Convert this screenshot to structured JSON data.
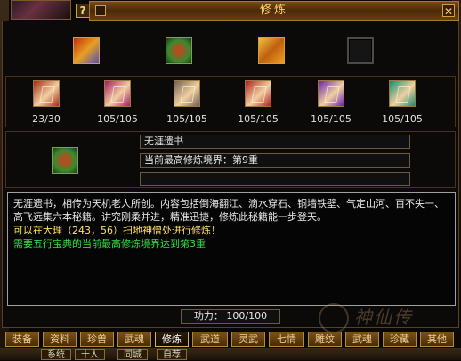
{
  "window": {
    "title": "修炼",
    "help_label": "?",
    "close_label": "✕"
  },
  "top_slots": [
    {
      "icon": "red-scroll-icon"
    },
    {
      "icon": "green-treasure-icon"
    },
    {
      "icon": "gold-scroll-icon"
    },
    {
      "icon": "empty-slot"
    }
  ],
  "books": [
    {
      "count": "23/30",
      "color": "#a82818"
    },
    {
      "count": "105/105",
      "color": "#a8186a"
    },
    {
      "count": "105/105",
      "color": "#706050"
    },
    {
      "count": "105/105",
      "color": "#b02020"
    },
    {
      "count": "105/105",
      "color": "#6a20b0"
    },
    {
      "count": "105/105",
      "color": "#109070"
    }
  ],
  "selected": {
    "name": "无涯遗书",
    "realm": "当前最高修炼境界：第9重",
    "extra": ""
  },
  "description": {
    "text": "无涯遗书，相传为天机老人所创。内容包括倒海翻江、滴水穿石、铜墙铁壁、气定山河、百不失一、高飞远集六本秘籍。讲究刚柔并进，精准迅捷，修炼此秘籍能一步登天。",
    "location": "可以在大理（243，56）扫地神僧处进行修炼！",
    "requirement": "需要五行宝典的当前最高修炼境界达到第3重"
  },
  "gongli": "功力：  100/100",
  "tabs": [
    "装备",
    "资料",
    "珍兽",
    "武魂",
    "修炼",
    "武道",
    "灵武",
    "七情",
    "雕纹",
    "武魂",
    "珍藏",
    "其他"
  ],
  "active_tab": "修炼",
  "bottom_tabs": [
    "系统",
    "十人",
    "同城",
    "自荐"
  ],
  "watermark": "神仙传"
}
